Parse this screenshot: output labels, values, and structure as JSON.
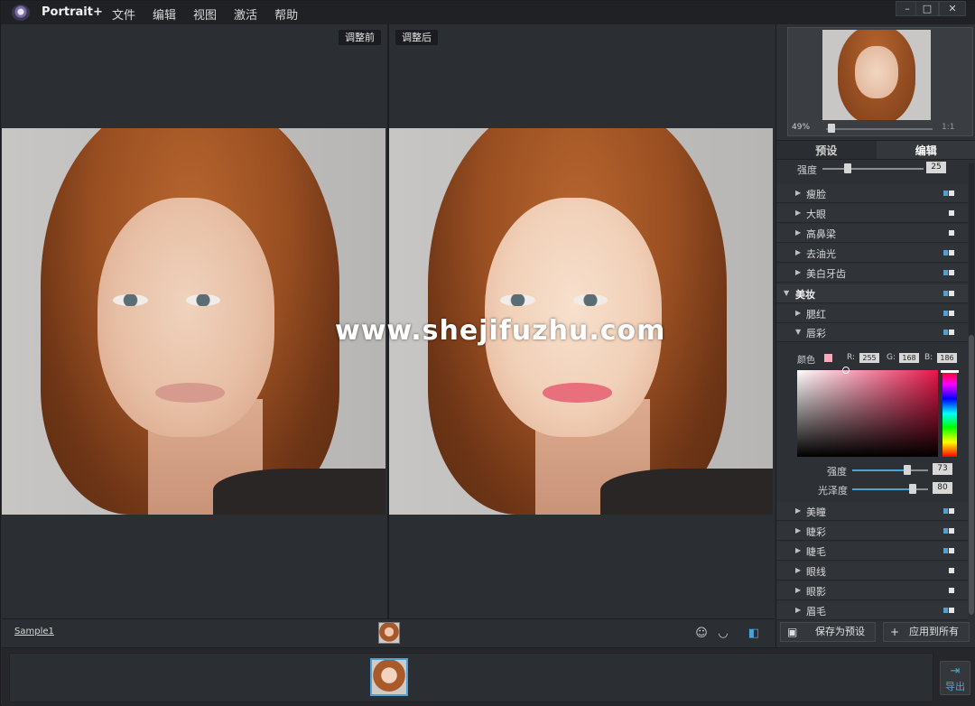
{
  "app": {
    "title": "Portrait+",
    "menu": [
      "文件",
      "编辑",
      "视图",
      "激活",
      "帮助"
    ],
    "window_controls": [
      "–",
      "□",
      "✕"
    ]
  },
  "preview": {
    "before_label": "调整前",
    "after_label": "调整后"
  },
  "bottom_bar": {
    "file_name": "Sample1",
    "export_label": "导出",
    "export_icon": "export-icon"
  },
  "navigator": {
    "zoom": "49%",
    "fit_label": "1:1"
  },
  "tabs": [
    "预设",
    "编辑"
  ],
  "strength_top": {
    "label": "强度",
    "value": "25",
    "level": 0.25
  },
  "features": [
    {
      "name": "瘦脸",
      "on": true
    },
    {
      "name": "大眼",
      "on": false
    },
    {
      "name": "高鼻梁",
      "on": false
    },
    {
      "name": "去油光",
      "on": true
    },
    {
      "name": "美白牙齿",
      "on": true
    }
  ],
  "makeup_group": {
    "name": "美妆",
    "on": true
  },
  "makeup_items_top": [
    {
      "name": "腮红",
      "on": true
    },
    {
      "name": "唇彩",
      "on": true
    }
  ],
  "lip_color": {
    "color_label": "颜色",
    "r_label": "R:",
    "r": "255",
    "g_label": "G:",
    "g": "168",
    "b_label": "B:",
    "b": "186",
    "swatch": "#ffa8ba",
    "strength_label": "强度",
    "strength": "73",
    "strength_level": 0.73,
    "gloss_label": "光泽度",
    "gloss": "80",
    "gloss_level": 0.8
  },
  "makeup_items_bottom": [
    {
      "name": "美瞳",
      "on": true
    },
    {
      "name": "睫彩",
      "on": true
    },
    {
      "name": "睫毛",
      "on": true
    },
    {
      "name": "眼线",
      "on": false
    },
    {
      "name": "眼影",
      "on": false
    },
    {
      "name": "眉毛",
      "on": true
    }
  ],
  "actions": {
    "save_preset": "保存为预设",
    "apply_all": "应用到所有"
  },
  "watermark": "www.shejifuzhu.com",
  "colors": {
    "accent": "#4aa3d8",
    "panel": "#2d3035",
    "titlebar": "#1f2124"
  }
}
